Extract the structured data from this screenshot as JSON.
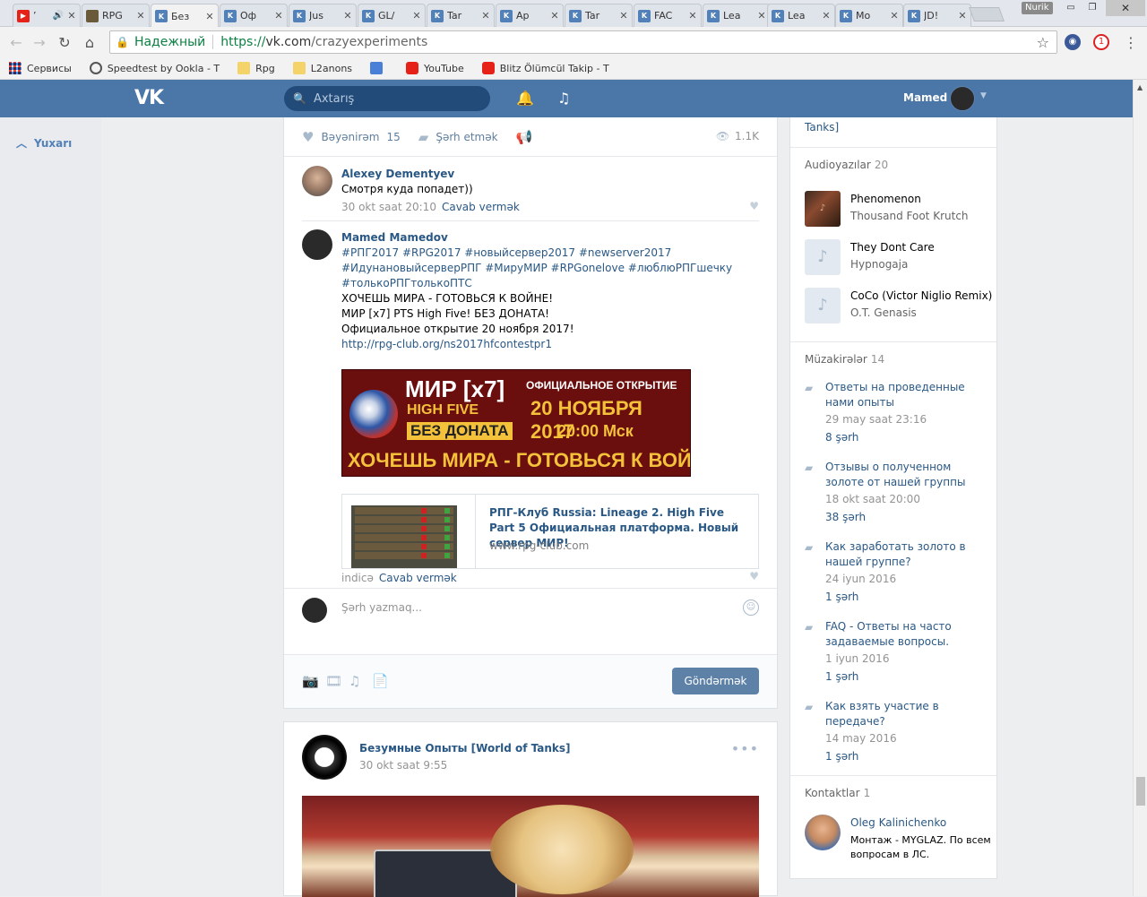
{
  "browser": {
    "tabs": [
      {
        "label": "’",
        "icon": "youtube-icon"
      },
      {
        "label": "RPG",
        "icon": "rpg-favicon"
      },
      {
        "label": "Без",
        "icon": "vk-favicon"
      },
      {
        "label": "Оф",
        "icon": "vk-favicon"
      },
      {
        "label": "Jus",
        "icon": "vk-favicon"
      },
      {
        "label": "GL/",
        "icon": "vk-favicon"
      },
      {
        "label": "Tar",
        "icon": "vk-favicon"
      },
      {
        "label": "Ар",
        "icon": "vk-favicon"
      },
      {
        "label": "Tar",
        "icon": "vk-favicon"
      },
      {
        "label": "FAC",
        "icon": "vk-favicon"
      },
      {
        "label": "Lea",
        "icon": "vk-favicon"
      },
      {
        "label": "Lea",
        "icon": "vk-favicon"
      },
      {
        "label": "Mo",
        "icon": "vk-favicon"
      },
      {
        "label": "JD!",
        "icon": "vk-favicon"
      }
    ],
    "active_tab": 2,
    "profile_chip": "Nurik",
    "secure_label": "Надежный",
    "url_proto": "https://",
    "url_host": "vk.com",
    "url_path": "/crazyexperiments",
    "extension_badge": "1",
    "bookmarks": [
      {
        "label": "Сервисы",
        "icon": "apps-grid-icon"
      },
      {
        "label": "Speedtest by Ookla - T",
        "icon": "speedtest-icon"
      },
      {
        "label": "Rpg",
        "icon": "folder-icon"
      },
      {
        "label": "L2anons",
        "icon": "folder-icon"
      },
      {
        "label": "",
        "icon": "translate-icon"
      },
      {
        "label": "YouTube",
        "icon": "youtube-icon"
      },
      {
        "label": "Blitz Ölümcül Takip - T",
        "icon": "youtube-icon"
      }
    ]
  },
  "vk": {
    "logo": "VK",
    "search_placeholder": "Axtarış",
    "user_name": "Mamed",
    "up_label": "Yuxarı"
  },
  "post": {
    "like_label": "Bəyənirəm",
    "like_count": "15",
    "comment_label": "Şərh etmək",
    "views": "1.1K",
    "comments": [
      {
        "author": "Alexey Dementyev",
        "text": "Смотря куда попадет))",
        "date": "30 okt saat 20:10",
        "reply": "Cavab vermək"
      },
      {
        "author": "Mamed Mamedov",
        "hashtags_1": "#РПГ2017 #RPG2017 #новыйсервер2017 #newserver2017",
        "hashtags_2": "#ИдунановыйсерверРПГ #МируМИР #RPGonelove #люблюРПГшечку",
        "hashtags_3": "#толькоРПГтолькоПТС",
        "line_1": "ХОЧЕШЬ МИРА - ГОТОВЬСЯ К ВОЙНЕ!",
        "line_2": "МИР [x7] PTS High Five! БЕЗ ДОНАТА!",
        "line_3": "Официальное открытие 20 ноября 2017!",
        "link": "http://rpg-club.org/ns2017hfcontestpr1",
        "banner": {
          "t1": "МИР [x7]",
          "t2": "HIGH FIVE",
          "t3": "БЕЗ ДОНАТА",
          "t4": "ОФИЦИАЛЬНОЕ ОТКРЫТИЕ",
          "t5": "20 НОЯБРЯ 2017",
          "t6": "20:00 Мск",
          "t7": "ХОЧЕШЬ МИРА - ГОТОВЬСЯ К ВОЙНЕ"
        },
        "card_title": "РПГ-Клуб Russia: Lineage 2. High Five Part 5 Официальная платформа. Новый сервер МИР!",
        "card_domain": "www.rpg-club.com",
        "date": "indicə",
        "reply": "Cavab vermək"
      }
    ],
    "write_placeholder": "Şərh yazmaq...",
    "send_label": "Göndərmək"
  },
  "post2": {
    "author": "Безумные Опыты [World of Tanks]",
    "date": "30 okt saat 9:55"
  },
  "sidebar": {
    "top_text": "Tanks]",
    "audio_label": "Audioyazılar",
    "audio_count": "20",
    "audio": [
      {
        "title": "Phenomenon",
        "artist": "Thousand Foot Krutch"
      },
      {
        "title": "They Dont Care",
        "artist": "Hypnogaja"
      },
      {
        "title": "CoCo (Victor Niglio Remix)",
        "artist": "O.T. Genasis"
      }
    ],
    "disc_label": "Müzakirələr",
    "disc_count": "14",
    "discussions": [
      {
        "title": "Ответы на проведенные нами опыты",
        "date": "29 may saat 23:16",
        "count": "8 şərh"
      },
      {
        "title": "Отзывы о полученном золоте от нашей группы",
        "date": "18 okt saat 20:00",
        "count": "38 şərh"
      },
      {
        "title": "Как заработать золото в нашей группе?",
        "date": "24 iyun 2016",
        "count": "1 şərh"
      },
      {
        "title": "FAQ - Ответы на часто задаваемые вопросы.",
        "date": "1 iyun 2016",
        "count": "1 şərh"
      },
      {
        "title": "Как взять участие в передаче?",
        "date": "14 may 2016",
        "count": "1 şərh"
      }
    ],
    "contacts_label": "Kontaktlar",
    "contacts_count": "1",
    "contact_name": "Oleg Kalinichenko",
    "contact_desc": "Монтаж - MYGLAZ. По всем вопросам в ЛС."
  }
}
